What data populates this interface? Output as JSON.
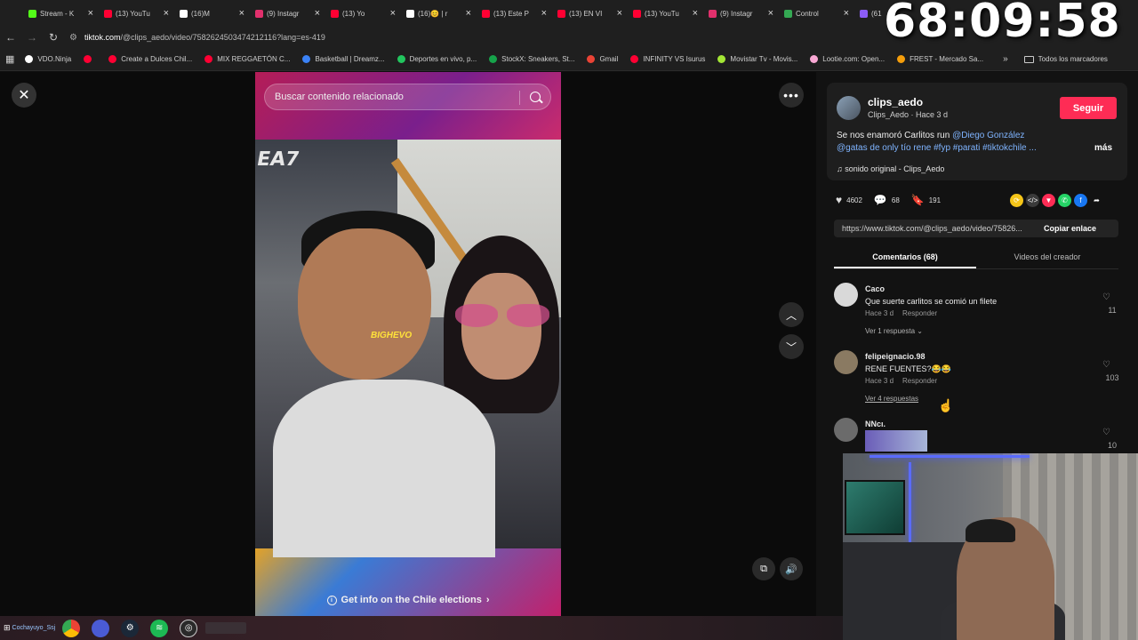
{
  "timer": "68:09:58",
  "browser": {
    "tabs": [
      {
        "label": "Stream - K",
        "color": "#53fc18"
      },
      {
        "label": "(13) YouTu",
        "color": "#ff0033"
      },
      {
        "label": "(16)M",
        "color": "#ffffff"
      },
      {
        "label": "(9) Instagr",
        "color": "#e1306c"
      },
      {
        "label": "(13) Yo",
        "color": "#ff0033"
      },
      {
        "label": "(16)😊 | r",
        "color": "#ffffff"
      },
      {
        "label": "(13) Este P",
        "color": "#ff0033"
      },
      {
        "label": "(13) EN VI",
        "color": "#ff0033"
      },
      {
        "label": "(13) YouTu",
        "color": "#ff0033"
      },
      {
        "label": "(9) Instagr",
        "color": "#e1306c"
      },
      {
        "label": "Control",
        "color": "#34a853"
      },
      {
        "label": "(61",
        "color": "#8b5cf6"
      }
    ],
    "url_domain": "tiktok.com",
    "url_path": "/@clips_aedo/video/7582624503474212116?lang=es-419",
    "bookmarks": [
      {
        "label": "VDO.Ninja",
        "color": "#ffffff"
      },
      {
        "label": "",
        "color": "#ff0033"
      },
      {
        "label": "Create a Dulces Chil...",
        "color": "#ff0033"
      },
      {
        "label": "MIX REGGAETÓN C...",
        "color": "#ff0033"
      },
      {
        "label": "Basketball | Dreamz...",
        "color": "#3b82f6"
      },
      {
        "label": "Deportes en vivo, p...",
        "color": "#22c55e"
      },
      {
        "label": "StockX: Sneakers, St...",
        "color": "#16a34a"
      },
      {
        "label": "Gmail",
        "color": "#ea4335"
      },
      {
        "label": "INFINITY VS Isurus",
        "color": "#ff0033"
      },
      {
        "label": "Movistar Tv - Movis...",
        "color": "#a3e635"
      },
      {
        "label": "Lootie.com: Open...",
        "color": "#f9a8d4"
      },
      {
        "label": "FREST - Mercado Sa...",
        "color": "#f59e0b"
      }
    ],
    "bookmarks_all": "Todos los marcadores"
  },
  "video": {
    "search_placeholder": "Buscar contenido relacionado",
    "elections_banner": "Get info on the Chile elections",
    "sticker_text": "BIGHEVO"
  },
  "panel": {
    "username": "clips_aedo",
    "subline": "Clips_Aedo · Hace 3 d",
    "follow_label": "Seguir",
    "desc_text": "Se nos enamoró Carlitos run ",
    "desc_tags_1": "@Diego González",
    "desc_tags_2": "@gatas de only tío rene #fyp #parati #tiktokchile ...",
    "more_label": "más",
    "sound": "sonido original - Clips_Aedo",
    "likes": "4602",
    "comments_count": "68",
    "saves": "191",
    "link": "https://www.tiktok.com/@clips_aedo/video/75826...",
    "copy_label": "Copiar enlace",
    "tab_comments": "Comentarios (68)",
    "tab_videos": "Videos del creador",
    "comments": [
      {
        "user": "Caco",
        "text": "Que suerte carlitos se comió un filete",
        "time": "Hace 3 d",
        "reply": "Responder",
        "likes": "11",
        "replies": "Ver 1 respuesta ⌄",
        "avatar": "#d9d9d9"
      },
      {
        "user": "felipeignacio.98",
        "text": "RENE FUENTES?😂😂",
        "time": "Hace 3 d",
        "reply": "Responder",
        "likes": "103",
        "replies": "Ver 4 respuestas",
        "avatar": "#8a7a62"
      },
      {
        "user": "NNcı.",
        "text": "",
        "time": "",
        "reply": "",
        "likes": "10",
        "replies": "",
        "avatar": "#6b6b6b"
      }
    ]
  },
  "taskbar": {
    "user_label": "Cochayuyo_Ssj"
  }
}
